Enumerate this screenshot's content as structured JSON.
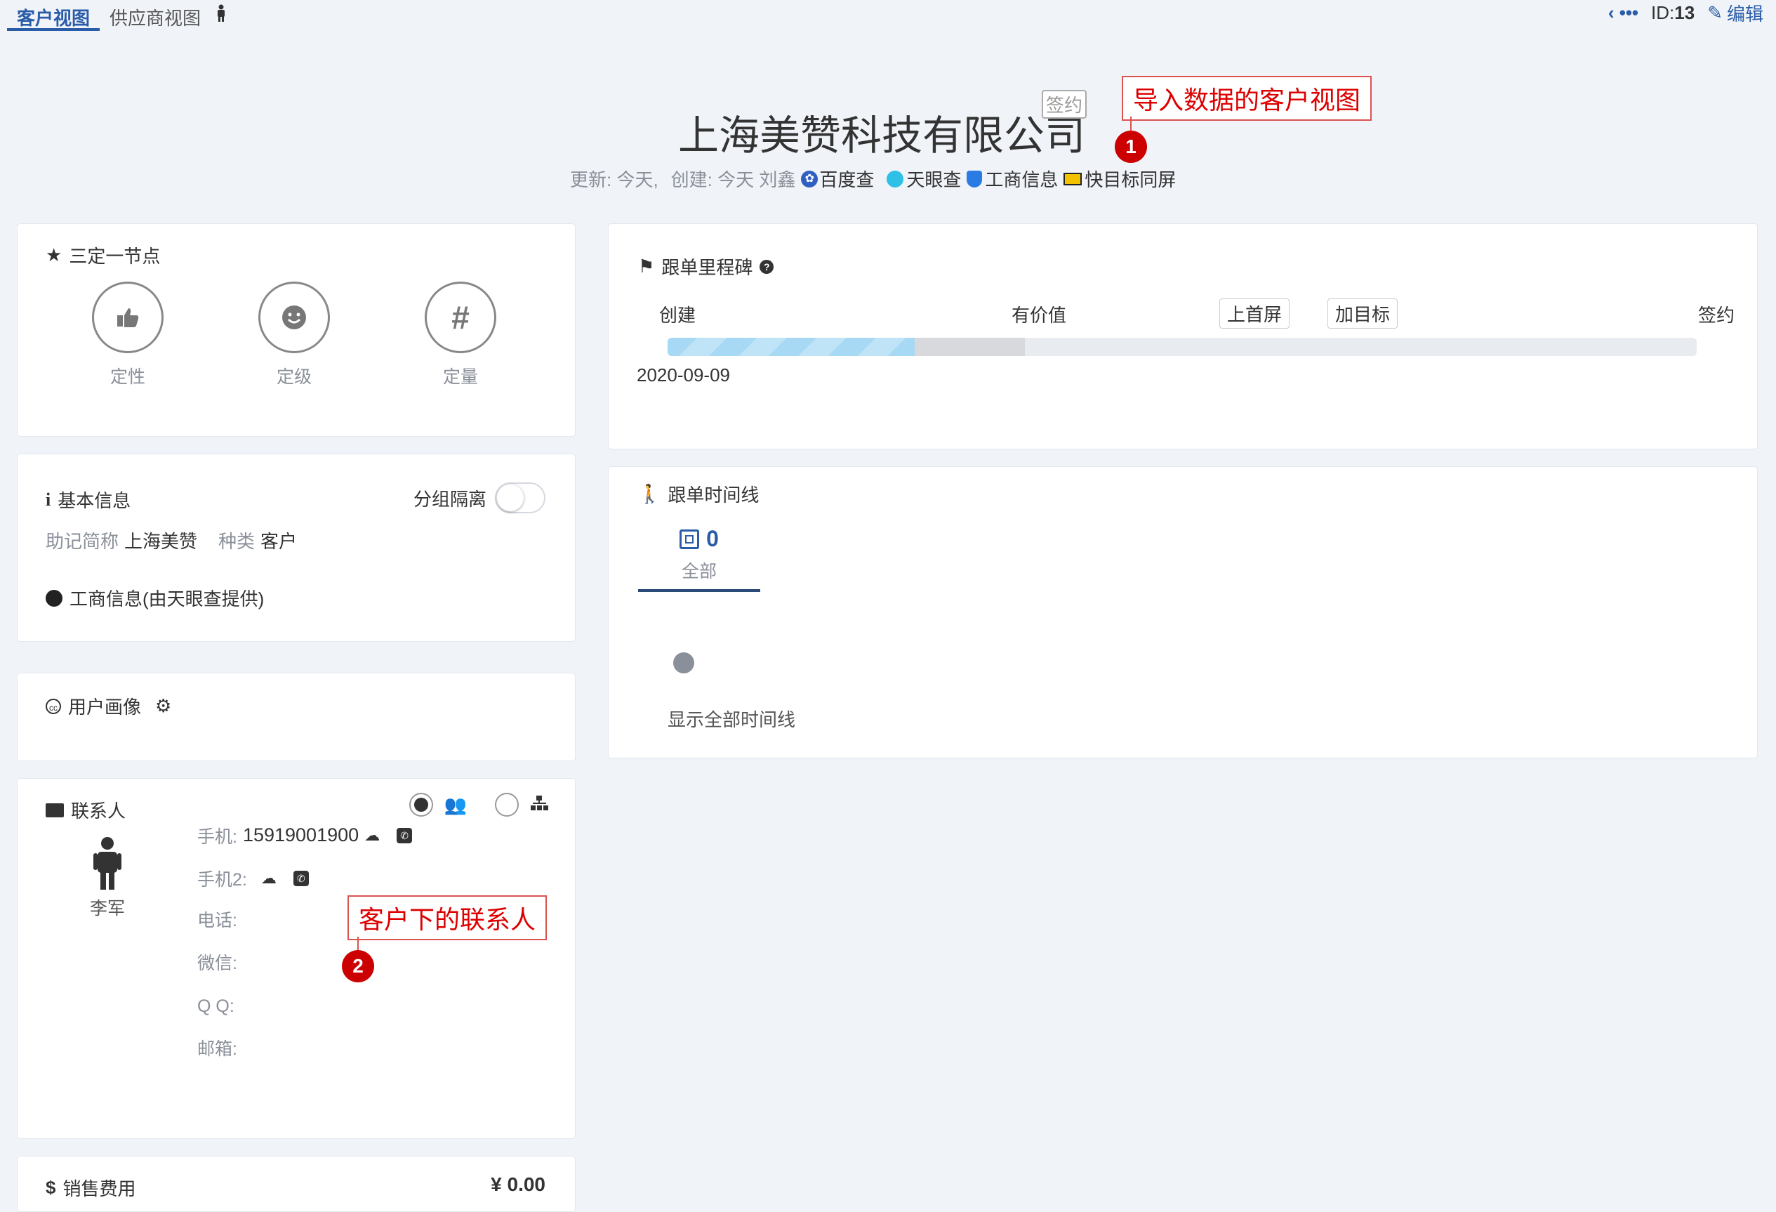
{
  "tabs": {
    "customer_view": "客户视图",
    "supplier_view": "供应商视图"
  },
  "top_right": {
    "id_label": "ID:",
    "id_value": "13",
    "edit": "编辑"
  },
  "company": {
    "name": "上海美赞科技有限公司",
    "status_tag": "签约",
    "meta_update": "更新: 今天,",
    "meta_create": "创建: 今天 刘鑫",
    "links": {
      "baidu": "百度查",
      "tianyancha": "天眼查",
      "business": "工商信息",
      "quick": "快目标同屏"
    }
  },
  "annotations": [
    {
      "text": "导入数据的客户视图",
      "num": "1"
    },
    {
      "text": "客户下的联系人",
      "num": "2"
    }
  ],
  "sanding": {
    "title": "三定一节点",
    "nodes": [
      {
        "label": "定性"
      },
      {
        "label": "定级"
      },
      {
        "label": "定量"
      }
    ]
  },
  "basic_info": {
    "title": "基本信息",
    "group_isolation": "分组隔离",
    "mnemonic_label": "助记简称",
    "mnemonic_value": "上海美赞",
    "type_label": "种类",
    "type_value": "客户",
    "business_info": "工商信息(由天眼查提供)"
  },
  "user_profile": {
    "title": "用户画像"
  },
  "contacts": {
    "title": "联系人",
    "person_name": "李军",
    "fields": {
      "mobile_label": "手机:",
      "mobile_value": "15919001900",
      "mobile2_label": "手机2:",
      "phone_label": "电话:",
      "wechat_label": "微信:",
      "qq_label": "Q Q:",
      "email_label": "邮箱:"
    }
  },
  "sales_cost": {
    "title": "销售费用",
    "value": "¥ 0.00"
  },
  "milestone": {
    "title": "跟单里程碑",
    "stages": [
      "创建",
      "有价值",
      "上首屏",
      "加目标",
      "签约"
    ],
    "progress": 0.24,
    "date": "2020-09-09"
  },
  "timeline": {
    "title": "跟单时间线",
    "count": "0",
    "tab_all": "全部",
    "show_all": "显示全部时间线"
  },
  "colors": {
    "accent": "#2a5ca8",
    "annotation": "#cc0000",
    "progress": "#9fd3f0"
  }
}
